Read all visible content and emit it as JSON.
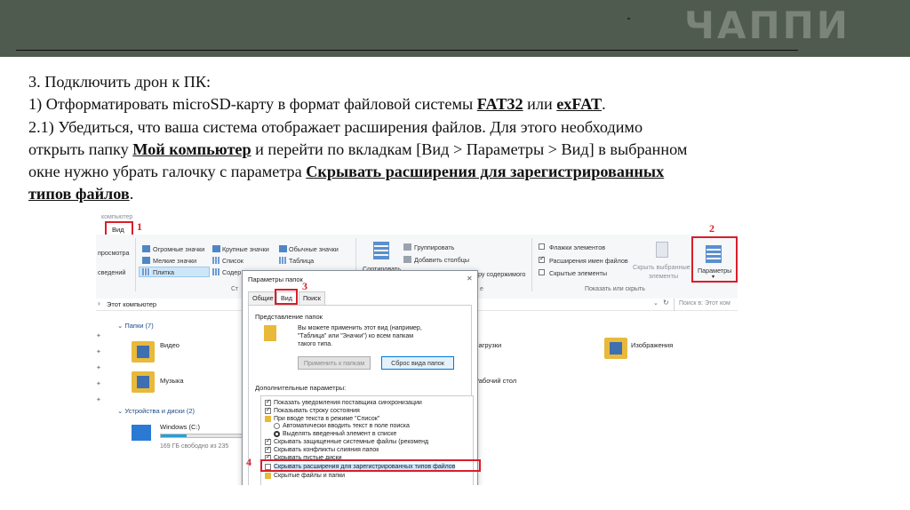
{
  "header": {
    "logo": "ЧАППИ",
    "bg_color": "#505b4f",
    "logo_color": "#7b8479"
  },
  "slide": {
    "line1": "3. Подключить дрон к ПК:",
    "line2_pre": "1) Отформатировать microSD-карту в формат файловой системы ",
    "line2_fat": "FAT32",
    "line2_mid": " или ",
    "line2_exfat": "exFAT",
    "line2_end": ".",
    "line3": "2.1) Убедиться, что ваша система отображает расширения файлов. Для этого необходимо",
    "line4_pre": "открыть папку ",
    "line4_bold": "Мой компьютер",
    "line4_post": " и перейти по вкладкам [Вид > Параметры > Вид] в выбранном",
    "line5_pre": "окне нужно убрать галочку с параметра ",
    "line5_bold": "Скрывать расширения для зарегистрированных",
    "line6_bold": "типов файлов",
    "line6_end": "."
  },
  "screenshot": {
    "window_caption": "компьютер",
    "tab_view": "Вид",
    "ribbon": {
      "preview": "просмотра",
      "details": "сведений",
      "huge_icons": "Огромные значки",
      "large_icons": "Крупные значки",
      "normal_icons": "Обычные значки",
      "small_icons": "Мелкие значки",
      "list": "Список",
      "table": "Таблица",
      "tile": "Плитка",
      "content": "Содер",
      "sort": "Сортировать",
      "group": "Группировать",
      "add_columns": "Добавить столбцы",
      "fit_content": "ру содержимого",
      "flags": "Флажки элементов",
      "extensions": "Расширения имен файлов",
      "hidden": "Скрытые элементы",
      "hide_selected_1": "Скрыть выбранные",
      "hide_selected_2": "элементы",
      "show_hide": "Показать или скрыть",
      "params": "Параметры",
      "group_char": "Ст",
      "group_char2": "е"
    },
    "address": "Этот компьютер",
    "search": "Поиск в: Этот ком",
    "folders_header": "Папки (7)",
    "video": "Видео",
    "music": "Музыка",
    "downloads": "Загрузки",
    "images": "Изображения",
    "desktop": "Рабочий стол",
    "devices_header": "Устройства и диски (2)",
    "windows_drive": "Windows (C:)",
    "drive_free": "169 ГБ свободно из 235",
    "drive_fill_fraction": 0.3,
    "markers": {
      "m1": "1",
      "m2": "2",
      "m3": "3",
      "m4": "4"
    },
    "dialog": {
      "title": "Параметры папок",
      "close": "✕",
      "tab_general": "Общие",
      "tab_view": "Вид",
      "tab_search": "Поиск",
      "folder_view_title": "Представление папок",
      "folder_view_desc1": "Вы можете применить этот вид (например,",
      "folder_view_desc2": "\"Таблица\" или \"Значки\") ко всем папкам",
      "folder_view_desc3": "такого типа.",
      "apply_btn": "Применить к папкам",
      "reset_btn": "Сброс вида папок",
      "advanced_title": "Дополнительные параметры:",
      "items": [
        "Показать уведомления поставщика синхронизации",
        "Показывать строку состояния",
        "При вводе текста в режиме \"Список\"",
        "Автоматически вводить текст в поле поиска",
        "Выделять введенный элемент в списке",
        "Скрывать защищенные системные файлы (рекоменд",
        "Скрывать конфликты слияния папок",
        "Скрывать пустые диски",
        "Скрывать расширения для зарегистрированных типов файлов",
        "Скрытые файлы и папки"
      ]
    }
  }
}
